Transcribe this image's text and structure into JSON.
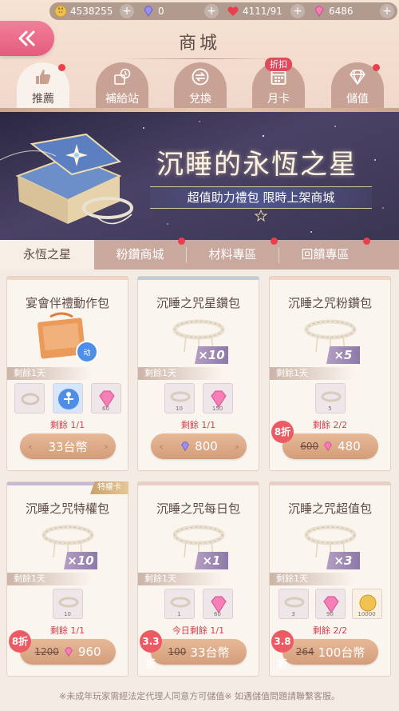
{
  "currency": {
    "coins": "4538255",
    "diamonds_blue": "0",
    "hearts": "4111/91",
    "diamonds_pink": "6486"
  },
  "header": {
    "title": "商城",
    "back_icon": "double-chevron-left-icon"
  },
  "nav_tabs": [
    {
      "label": "推薦",
      "icon": "thumbs-up-icon",
      "active": true
    },
    {
      "label": "補給站",
      "icon": "clock-package-icon",
      "active": false
    },
    {
      "label": "兌換",
      "icon": "exchange-icon",
      "active": false
    },
    {
      "label": "月卡",
      "icon": "calendar-card-icon",
      "active": false,
      "tag": "折扣"
    },
    {
      "label": "儲值",
      "icon": "diamond-icon",
      "active": false
    }
  ],
  "banner": {
    "title": "沉睡的永恆之星",
    "subtitle": "超值助力禮包 限時上架商城"
  },
  "sub_tabs": [
    {
      "label": "永恆之星",
      "active": true
    },
    {
      "label": "粉鑽商城",
      "active": false
    },
    {
      "label": "材料專區",
      "active": false
    },
    {
      "label": "回饋專區",
      "active": false
    }
  ],
  "cards": [
    {
      "name": "宴會伴禮動作包",
      "qty": "",
      "time_left": "剩餘1天",
      "items": [
        {
          "count": ""
        },
        {
          "count": ""
        },
        {
          "count": "60"
        }
      ],
      "limit": "剩餘 1/1",
      "discount": "",
      "old_price": "",
      "price": "33台幣",
      "price_icon": ""
    },
    {
      "name": "沉睡之咒星鑽包",
      "qty": "×10",
      "time_left": "剩餘1天",
      "items": [
        {
          "count": "10"
        },
        {
          "count": "150"
        }
      ],
      "limit": "剩餘 1/1",
      "discount": "",
      "old_price": "",
      "price": "800",
      "price_icon": "blue-diamond-icon"
    },
    {
      "name": "沉睡之咒粉鑽包",
      "qty": "×5",
      "time_left": "剩餘1天",
      "items": [
        {
          "count": "5"
        }
      ],
      "limit": "剩餘 2/2",
      "discount": "8折",
      "old_price": "600",
      "price": "480",
      "price_icon": "pink-diamond-icon"
    },
    {
      "name": "沉睡之咒特權包",
      "qty": "×10",
      "time_left": "剩餘1天",
      "items": [
        {
          "count": "10"
        }
      ],
      "limit": "剩餘 1/1",
      "discount": "8折",
      "old_price": "1200",
      "price": "960",
      "price_icon": "pink-diamond-icon",
      "tag": "特權卡"
    },
    {
      "name": "沉睡之咒每日包",
      "qty": "×1",
      "time_left": "剩餘1天",
      "items": [
        {
          "count": "1"
        },
        {
          "count": "60"
        }
      ],
      "limit": "今日剩餘 1/1",
      "discount": "3.3折",
      "old_price": "100",
      "price": "33台幣",
      "price_icon": ""
    },
    {
      "name": "沉睡之咒超值包",
      "qty": "×3",
      "time_left": "剩餘1天",
      "items": [
        {
          "count": "3"
        },
        {
          "count": "90"
        },
        {
          "count": "10000"
        }
      ],
      "limit": "剩餘 2/2",
      "discount": "3.8折",
      "old_price": "264",
      "price": "100台幣",
      "price_icon": ""
    }
  ],
  "footer": {
    "note": "※未成年玩家需經法定代理人同意方可儲值※ 如遇儲值問題請聯繫客服。"
  },
  "colors": {
    "accent_pink": "#e45c7d",
    "price_button": "#d49d79",
    "limit_red": "#d8404d",
    "badge_red": "#ec5b63"
  }
}
